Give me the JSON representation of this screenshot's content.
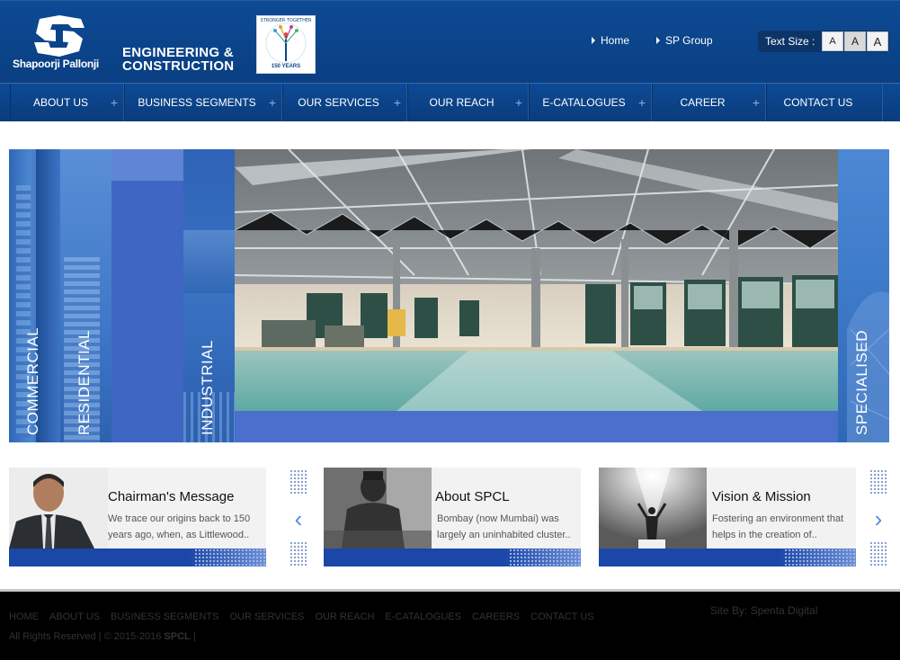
{
  "brand": {
    "logo_name": "Shapoorji Pallonji",
    "division_line1": "ENGINEERING &",
    "division_line2": "CONSTRUCTION",
    "badge_text": "STRONGER TOGETHER",
    "badge_years": "150 YEARS"
  },
  "top_links": [
    {
      "label": "Home"
    },
    {
      "label": "SP Group"
    }
  ],
  "text_size": {
    "label": "Text Size :",
    "options": [
      "A",
      "A",
      "A"
    ]
  },
  "nav": [
    {
      "label": "ABOUT US"
    },
    {
      "label": "BUSINESS SEGMENTS"
    },
    {
      "label": "OUR SERVICES"
    },
    {
      "label": "OUR REACH"
    },
    {
      "label": "E-CATALOGUES"
    },
    {
      "label": "CAREER"
    },
    {
      "label": "CONTACT US"
    }
  ],
  "banner": {
    "segments": [
      "COMMERCIAL",
      "RESIDENTIAL",
      "INDUSTRIAL",
      "SPECIALISED"
    ]
  },
  "cards": [
    {
      "title": "Chairman's Message",
      "text": "We trace our origins back to 150 years ago, when, as Littlewood.."
    },
    {
      "title": "About SPCL",
      "text": "Bombay (now Mumbai) was largely an uninhabited cluster.."
    },
    {
      "title": "Vision & Mission",
      "text": "Fostering an environment that helps in the creation of.."
    }
  ],
  "footer": {
    "links": [
      "HOME",
      "ABOUT US",
      "BUSINESS SEGMENTS",
      "OUR SERVICES",
      "OUR REACH",
      "E-CATALOGUES",
      "CAREERS",
      "CONTACT US"
    ],
    "copyright_prefix": "All Rights Reserved | © 2015-2016",
    "copyright_company": "SPCL",
    "copyright_suffix": "|",
    "site_by": "Site By: Spenta Digital"
  },
  "colors": {
    "header_blue": "#0b4389",
    "accent_blue": "#1b47a8",
    "banner_blue": "#3d66c0"
  },
  "icons": {
    "prev": "chevron-left-icon",
    "next": "chevron-right-icon",
    "nav_expand": "plus-icon"
  }
}
